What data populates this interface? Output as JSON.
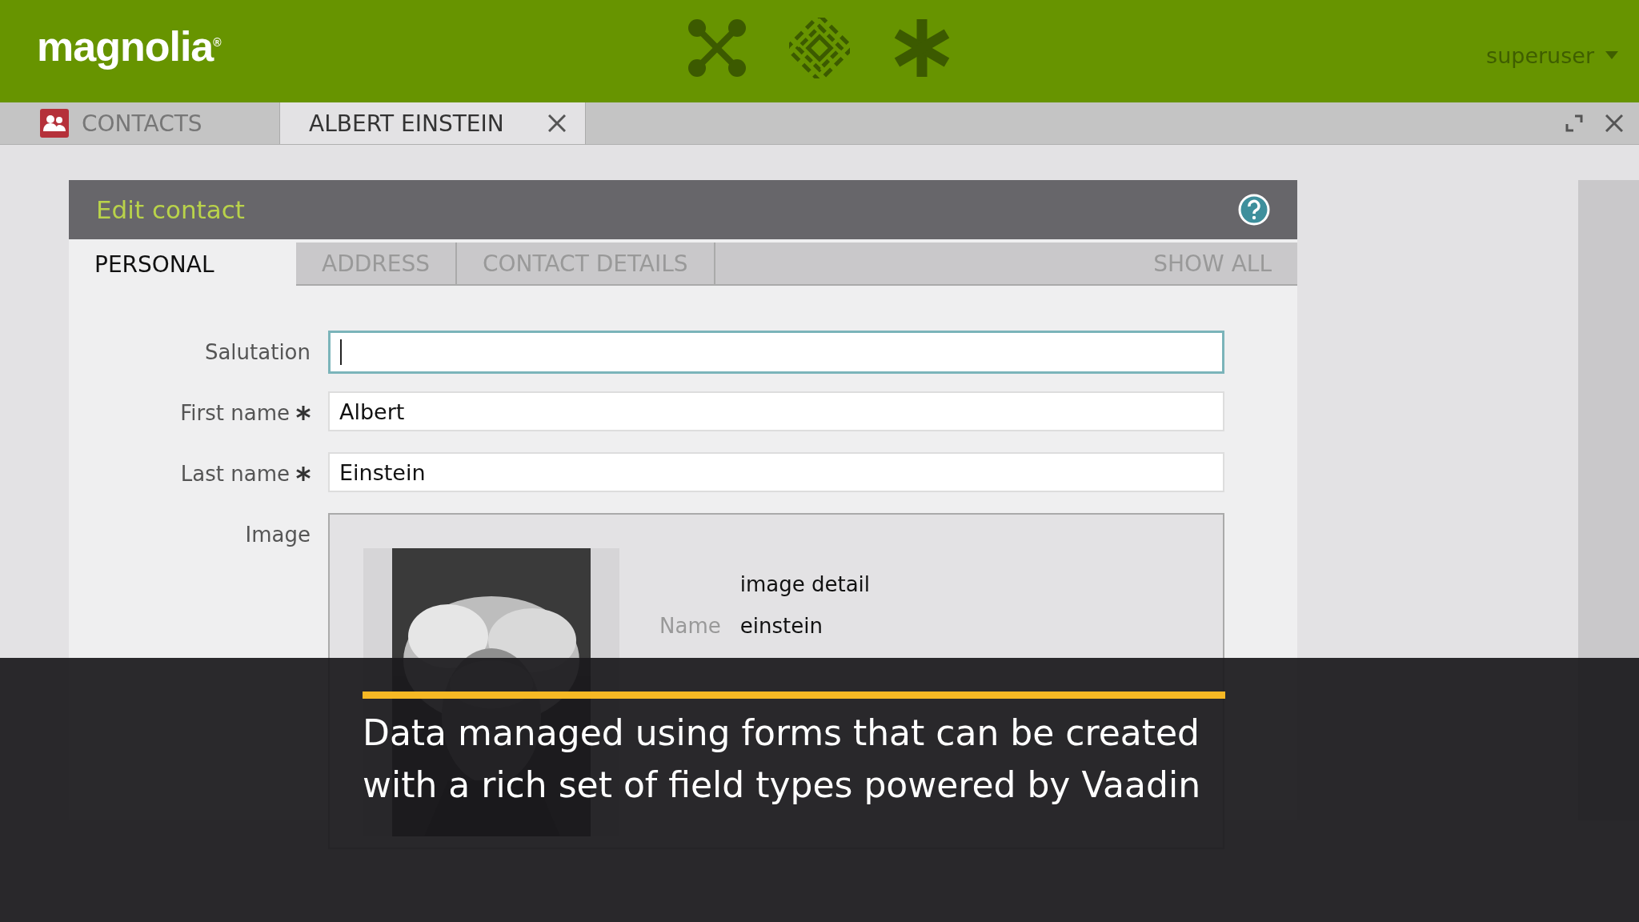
{
  "header": {
    "logo": "magnolia$^{®}$",
    "user": "superuser"
  },
  "app_tabs": [
    {
      "label": "CONTACTS",
      "selected": false,
      "kind": "app"
    },
    {
      "label": "ALBERT EINSTEIN",
      "selected": true,
      "kind": "item"
    }
  ],
  "dialog": {
    "title": "Edit contact",
    "tabs": [
      {
        "label": "PERSONAL",
        "selected": true
      },
      {
        "label": "ADDRESS",
        "selected": false
      },
      {
        "label": "CONTACT DETAILS",
        "selected": false
      }
    ],
    "show_all": "SHOW ALL",
    "fields": [
      {
        "label": "Salutation",
        "required": false,
        "focused": true
      },
      {
        "label": "First name",
        "required": true,
        "focused": false,
        "value": "Albert"
      },
      {
        "label": "Last name",
        "required": true,
        "focused": false,
        "value": "Einstein"
      }
    ],
    "image": {
      "label": "Image",
      "detail_title": "image detail",
      "details": [
        {
          "label": "Name",
          "value": "einstein"
        }
      ]
    }
  },
  "caption": {
    "lines": [
      "Data managed using forms that can be created",
      "with a rich set of field types powered by Vaadin"
    ]
  }
}
